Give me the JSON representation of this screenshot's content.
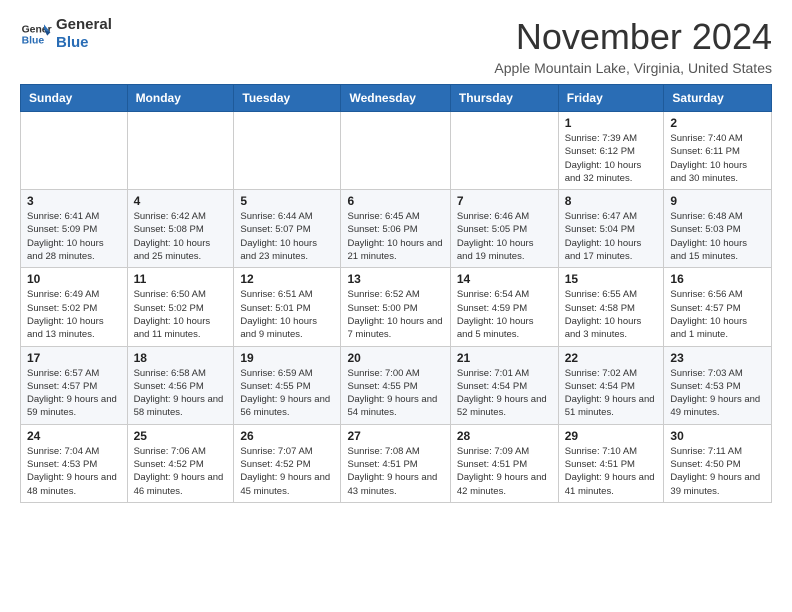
{
  "header": {
    "logo_line1": "General",
    "logo_line2": "Blue",
    "month_title": "November 2024",
    "location": "Apple Mountain Lake, Virginia, United States"
  },
  "days_of_week": [
    "Sunday",
    "Monday",
    "Tuesday",
    "Wednesday",
    "Thursday",
    "Friday",
    "Saturday"
  ],
  "weeks": [
    [
      {
        "day": "",
        "info": ""
      },
      {
        "day": "",
        "info": ""
      },
      {
        "day": "",
        "info": ""
      },
      {
        "day": "",
        "info": ""
      },
      {
        "day": "",
        "info": ""
      },
      {
        "day": "1",
        "info": "Sunrise: 7:39 AM\nSunset: 6:12 PM\nDaylight: 10 hours and 32 minutes."
      },
      {
        "day": "2",
        "info": "Sunrise: 7:40 AM\nSunset: 6:11 PM\nDaylight: 10 hours and 30 minutes."
      }
    ],
    [
      {
        "day": "3",
        "info": "Sunrise: 6:41 AM\nSunset: 5:09 PM\nDaylight: 10 hours and 28 minutes."
      },
      {
        "day": "4",
        "info": "Sunrise: 6:42 AM\nSunset: 5:08 PM\nDaylight: 10 hours and 25 minutes."
      },
      {
        "day": "5",
        "info": "Sunrise: 6:44 AM\nSunset: 5:07 PM\nDaylight: 10 hours and 23 minutes."
      },
      {
        "day": "6",
        "info": "Sunrise: 6:45 AM\nSunset: 5:06 PM\nDaylight: 10 hours and 21 minutes."
      },
      {
        "day": "7",
        "info": "Sunrise: 6:46 AM\nSunset: 5:05 PM\nDaylight: 10 hours and 19 minutes."
      },
      {
        "day": "8",
        "info": "Sunrise: 6:47 AM\nSunset: 5:04 PM\nDaylight: 10 hours and 17 minutes."
      },
      {
        "day": "9",
        "info": "Sunrise: 6:48 AM\nSunset: 5:03 PM\nDaylight: 10 hours and 15 minutes."
      }
    ],
    [
      {
        "day": "10",
        "info": "Sunrise: 6:49 AM\nSunset: 5:02 PM\nDaylight: 10 hours and 13 minutes."
      },
      {
        "day": "11",
        "info": "Sunrise: 6:50 AM\nSunset: 5:02 PM\nDaylight: 10 hours and 11 minutes."
      },
      {
        "day": "12",
        "info": "Sunrise: 6:51 AM\nSunset: 5:01 PM\nDaylight: 10 hours and 9 minutes."
      },
      {
        "day": "13",
        "info": "Sunrise: 6:52 AM\nSunset: 5:00 PM\nDaylight: 10 hours and 7 minutes."
      },
      {
        "day": "14",
        "info": "Sunrise: 6:54 AM\nSunset: 4:59 PM\nDaylight: 10 hours and 5 minutes."
      },
      {
        "day": "15",
        "info": "Sunrise: 6:55 AM\nSunset: 4:58 PM\nDaylight: 10 hours and 3 minutes."
      },
      {
        "day": "16",
        "info": "Sunrise: 6:56 AM\nSunset: 4:57 PM\nDaylight: 10 hours and 1 minute."
      }
    ],
    [
      {
        "day": "17",
        "info": "Sunrise: 6:57 AM\nSunset: 4:57 PM\nDaylight: 9 hours and 59 minutes."
      },
      {
        "day": "18",
        "info": "Sunrise: 6:58 AM\nSunset: 4:56 PM\nDaylight: 9 hours and 58 minutes."
      },
      {
        "day": "19",
        "info": "Sunrise: 6:59 AM\nSunset: 4:55 PM\nDaylight: 9 hours and 56 minutes."
      },
      {
        "day": "20",
        "info": "Sunrise: 7:00 AM\nSunset: 4:55 PM\nDaylight: 9 hours and 54 minutes."
      },
      {
        "day": "21",
        "info": "Sunrise: 7:01 AM\nSunset: 4:54 PM\nDaylight: 9 hours and 52 minutes."
      },
      {
        "day": "22",
        "info": "Sunrise: 7:02 AM\nSunset: 4:54 PM\nDaylight: 9 hours and 51 minutes."
      },
      {
        "day": "23",
        "info": "Sunrise: 7:03 AM\nSunset: 4:53 PM\nDaylight: 9 hours and 49 minutes."
      }
    ],
    [
      {
        "day": "24",
        "info": "Sunrise: 7:04 AM\nSunset: 4:53 PM\nDaylight: 9 hours and 48 minutes."
      },
      {
        "day": "25",
        "info": "Sunrise: 7:06 AM\nSunset: 4:52 PM\nDaylight: 9 hours and 46 minutes."
      },
      {
        "day": "26",
        "info": "Sunrise: 7:07 AM\nSunset: 4:52 PM\nDaylight: 9 hours and 45 minutes."
      },
      {
        "day": "27",
        "info": "Sunrise: 7:08 AM\nSunset: 4:51 PM\nDaylight: 9 hours and 43 minutes."
      },
      {
        "day": "28",
        "info": "Sunrise: 7:09 AM\nSunset: 4:51 PM\nDaylight: 9 hours and 42 minutes."
      },
      {
        "day": "29",
        "info": "Sunrise: 7:10 AM\nSunset: 4:51 PM\nDaylight: 9 hours and 41 minutes."
      },
      {
        "day": "30",
        "info": "Sunrise: 7:11 AM\nSunset: 4:50 PM\nDaylight: 9 hours and 39 minutes."
      }
    ]
  ]
}
